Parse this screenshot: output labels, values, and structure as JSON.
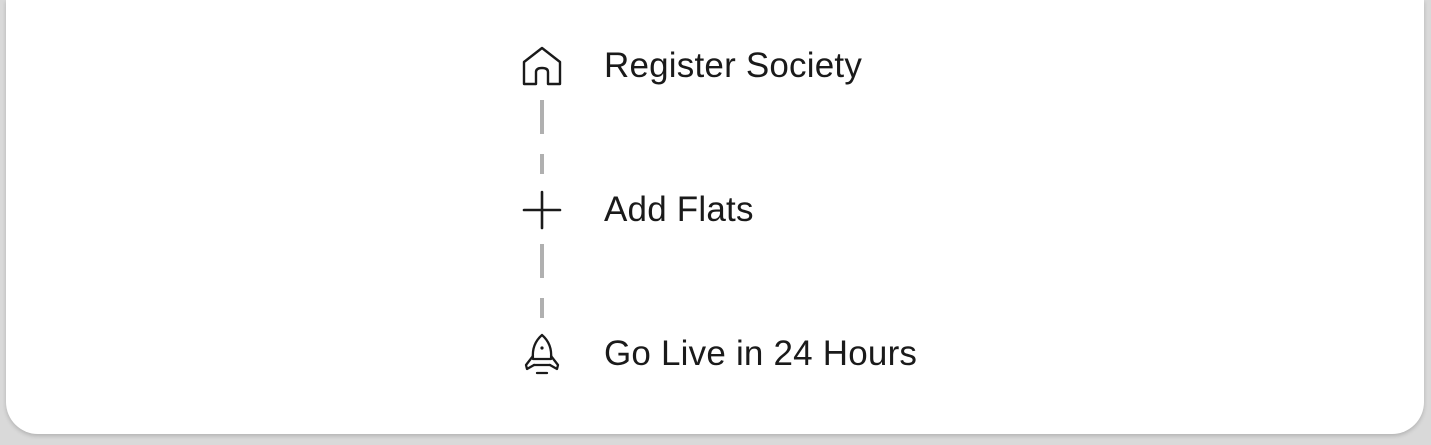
{
  "steps": [
    {
      "icon": "home-icon",
      "label": "Register Society"
    },
    {
      "icon": "plus-icon",
      "label": "Add Flats"
    },
    {
      "icon": "rocket-icon",
      "label": "Go Live in 24 Hours"
    }
  ],
  "colors": {
    "text": "#1a1a1a",
    "icon": "#1a1a1a",
    "connector": "#b0b0b0",
    "card": "#ffffff",
    "background": "#d9d9d9"
  }
}
